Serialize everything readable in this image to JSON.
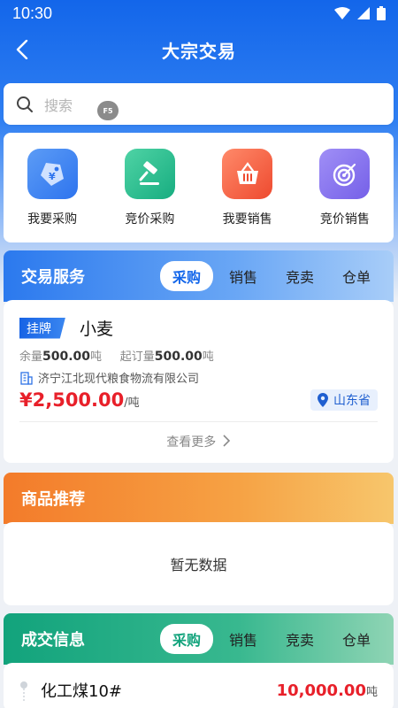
{
  "status": {
    "time": "10:30"
  },
  "header": {
    "title": "大宗交易"
  },
  "search": {
    "placeholder": "搜索",
    "badge": "F5"
  },
  "quick_actions": [
    {
      "label": "我要采购",
      "icon": "tag-icon",
      "color": "#3f86f2"
    },
    {
      "label": "竞价采购",
      "icon": "gavel-icon",
      "color": "#20b98b"
    },
    {
      "label": "我要销售",
      "icon": "basket-icon",
      "color": "#f05a3c"
    },
    {
      "label": "竞价销售",
      "icon": "target-icon",
      "color": "#8a72ee"
    }
  ],
  "trade_service": {
    "title": "交易服务",
    "tabs": [
      "采购",
      "销售",
      "竞卖",
      "仓单"
    ],
    "active_tab": "采购",
    "item": {
      "tag": "挂牌",
      "name": "小麦",
      "remain_label": "余量",
      "remain_value": "500.00",
      "remain_unit": "吨",
      "min_label": "起订量",
      "min_value": "500.00",
      "min_unit": "吨",
      "company": "济宁江北现代粮食物流有限公司",
      "price": "¥2,500.00",
      "price_unit": "/吨",
      "location": "山东省"
    },
    "more": "查看更多"
  },
  "recommend": {
    "title": "商品推荐",
    "empty": "暂无数据"
  },
  "deal_info": {
    "title": "成交信息",
    "tabs": [
      "采购",
      "销售",
      "竞卖",
      "仓单"
    ],
    "active_tab": "采购",
    "item": {
      "name": "化工煤10#",
      "price": "10,000.00",
      "price_unit": "吨"
    }
  }
}
